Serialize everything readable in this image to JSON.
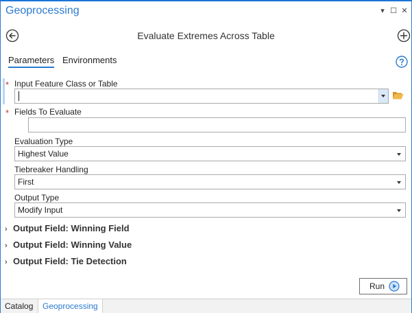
{
  "pane": {
    "title": "Geoprocessing",
    "controls": {
      "dropdown": "▾",
      "maximize": "☐",
      "close": "✕"
    }
  },
  "header": {
    "tool_title": "Evaluate Extremes Across Table",
    "back_icon": "back-arrow-icon",
    "add_icon": "add-icon"
  },
  "tabs": [
    {
      "label": "Parameters",
      "active": true
    },
    {
      "label": "Environments",
      "active": false
    }
  ],
  "params": {
    "input_feature": {
      "label": "Input Feature Class or Table",
      "required": "*",
      "value": ""
    },
    "fields": {
      "label": "Fields To Evaluate",
      "required": "*",
      "value": ""
    },
    "evaluation_type": {
      "label": "Evaluation Type",
      "value": "Highest Value"
    },
    "tiebreaker": {
      "label": "Tiebreaker Handling",
      "value": "First"
    },
    "output_type": {
      "label": "Output Type",
      "value": "Modify Input"
    }
  },
  "sections": [
    {
      "chevron": "›",
      "label": "Output Field: Winning Field"
    },
    {
      "chevron": "›",
      "label": "Output Field: Winning Value"
    },
    {
      "chevron": "›",
      "label": "Output Field: Tie Detection"
    }
  ],
  "run": {
    "label": "Run"
  },
  "bottom_tabs": [
    {
      "label": "Catalog",
      "active": false
    },
    {
      "label": "Geoprocessing",
      "active": true
    }
  ],
  "colors": {
    "accent": "#2a7ad0",
    "required": "#c0392b",
    "folder": "#e8a93a"
  }
}
